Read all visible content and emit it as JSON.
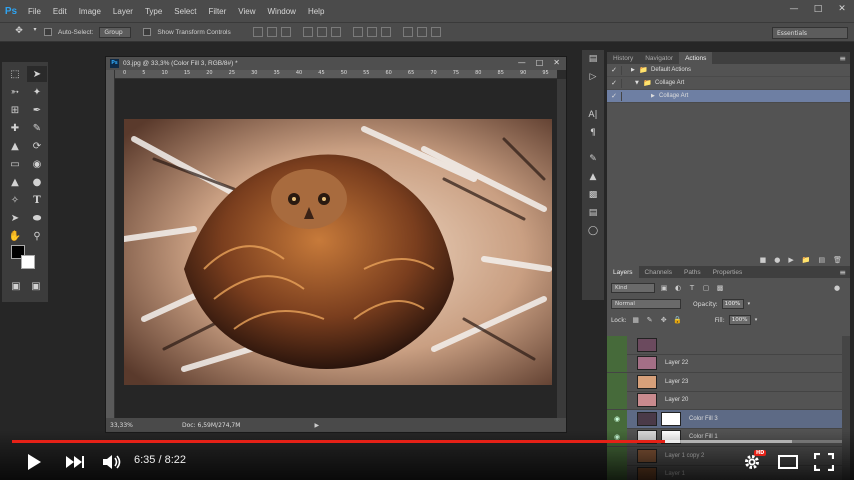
{
  "menubar": {
    "logo": "Ps",
    "items": [
      "File",
      "Edit",
      "Image",
      "Layer",
      "Type",
      "Select",
      "Filter",
      "View",
      "Window",
      "Help"
    ]
  },
  "options_bar": {
    "auto_select_label": "Auto-Select:",
    "auto_select_value": "Group",
    "show_transform_label": "Show Transform Controls",
    "workspace": "Essentials"
  },
  "document": {
    "title": "03.jpg @ 33,3% (Color Fill 3, RGB/8#) *",
    "ruler_numbers": [
      "0",
      "5",
      "10",
      "15",
      "20",
      "25",
      "30",
      "35",
      "40",
      "45",
      "50",
      "55",
      "60",
      "65",
      "70",
      "75",
      "80",
      "85",
      "90",
      "95"
    ],
    "zoom": "33,33%",
    "doc_info": "Doc: 6,59M/274,7M"
  },
  "actions_panel": {
    "tabs": [
      "History",
      "Navigator",
      "Actions"
    ],
    "active_tab": "Actions",
    "rows": [
      {
        "label": "Default Actions",
        "indent": 0,
        "selected": false
      },
      {
        "label": "Collage Art",
        "indent": 1,
        "selected": false
      },
      {
        "label": "Collage Art",
        "indent": 2,
        "selected": true
      }
    ]
  },
  "layers_panel": {
    "tabs": [
      "Layers",
      "Channels",
      "Paths",
      "Properties"
    ],
    "active_tab": "Layers",
    "filter": "Kind",
    "blend_mode": "Normal",
    "opacity_label": "Opacity:",
    "opacity": "100%",
    "lock_label": "Lock:",
    "fill_label": "Fill:",
    "fill": "100%",
    "layers": [
      {
        "name": "",
        "visible": false,
        "selected": false,
        "mask": false,
        "thumb": "#6b4a5e"
      },
      {
        "name": "Layer 22",
        "visible": false,
        "selected": false,
        "mask": false,
        "thumb": "#a46f86"
      },
      {
        "name": "Layer 23",
        "visible": false,
        "selected": false,
        "mask": false,
        "thumb": "#d7a07a"
      },
      {
        "name": "Layer 20",
        "visible": false,
        "selected": false,
        "mask": false,
        "thumb": "#c98a8e"
      },
      {
        "name": "Color Fill 3",
        "visible": true,
        "selected": true,
        "mask": true,
        "thumb": "#4a3a48"
      },
      {
        "name": "Color Fill 1",
        "visible": true,
        "selected": false,
        "mask": true,
        "thumb": "#d8d8d8"
      },
      {
        "name": "Layer 1 copy 2",
        "visible": false,
        "selected": false,
        "mask": false,
        "thumb": "#8a5a3a"
      },
      {
        "name": "Layer 1",
        "visible": false,
        "selected": false,
        "mask": false,
        "thumb": "#7a4a2a"
      }
    ]
  },
  "video_player": {
    "current_time": "6:35",
    "duration": "8:22",
    "time_display": "6:35 / 8:22",
    "played_fraction": 0.787,
    "buffered_fraction": 0.94,
    "hd_badge": "HD",
    "accent_color": "#e62117"
  }
}
